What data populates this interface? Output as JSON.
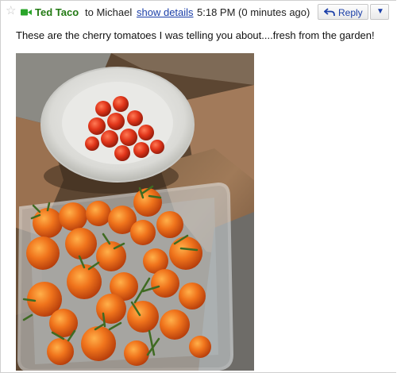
{
  "message": {
    "sender": "Ted Taco",
    "recipient_text": "to Michael",
    "show_details": "show details",
    "time": "5:18 PM (0 minutes ago)",
    "body": "These are the cherry tomatoes I was telling you about....fresh from the garden!"
  },
  "actions": {
    "reply_label": "Reply",
    "more_icon": "chevron-down-icon"
  },
  "icons": {
    "star": "star-icon",
    "presence": "video-camera-icon",
    "reply": "reply-arrow-icon"
  },
  "colors": {
    "sender": "#237a14",
    "link": "#1b3fa8",
    "presence": "#2aa52a"
  }
}
